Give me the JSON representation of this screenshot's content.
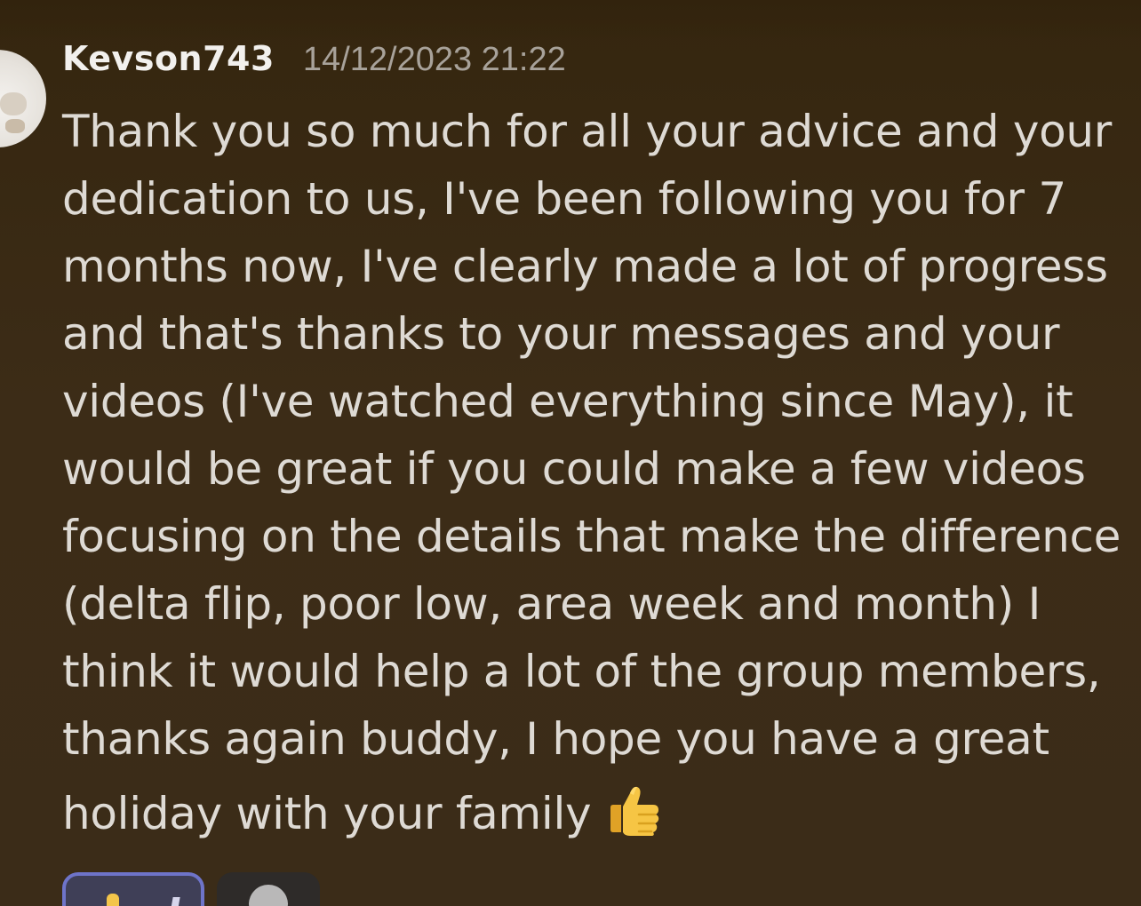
{
  "message": {
    "author": "Kevson743",
    "timestamp": "14/12/2023 21:22",
    "lines": [
      "Thank you so much for all your advice and your",
      "dedication to us, I've been following you for 7",
      "months now, I've clearly made a lot of progress",
      "and that's thanks to your messages and your",
      "videos (I've watched everything since May), it",
      "would be great if you could make a few videos",
      "focusing on the details that make the difference",
      "(delta flip, poor low, area week and month) I",
      "think it would help a lot of the group members,",
      "thanks again buddy, I hope you have a great",
      "holiday with your family"
    ],
    "trailing_emoji": "thumbs-up"
  },
  "reactions": [
    {
      "emoji": "thumbs-up",
      "selected": true
    },
    {
      "emoji": "add-reaction",
      "selected": false
    }
  ],
  "colors": {
    "background": "#3b2b16",
    "text": "#dedad4",
    "timestamp": "#a8a29a",
    "reaction_selected_border": "#6e74c9"
  }
}
